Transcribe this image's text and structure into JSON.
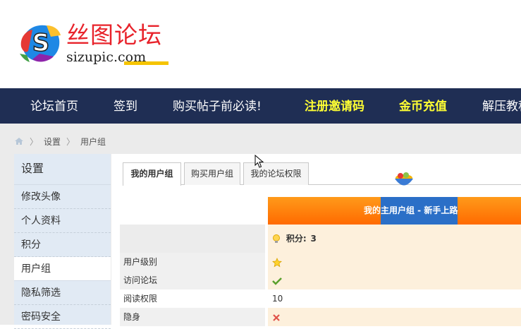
{
  "logo": {
    "title_cn": "丝图论坛",
    "domain": "sizupic.com",
    "mark_letter": "S"
  },
  "nav": {
    "items": [
      {
        "label": "论坛首页",
        "highlight": false
      },
      {
        "label": "签到",
        "highlight": false
      },
      {
        "label": "购买帖子前必读!",
        "highlight": false
      },
      {
        "label": "注册邀请码",
        "highlight": true
      },
      {
        "label": "金币充值",
        "highlight": true
      },
      {
        "label": "解压教程",
        "highlight": false
      }
    ],
    "bg_color": "#1f2e54",
    "highlight_color": "#ffff33"
  },
  "breadcrumb": {
    "home_icon": "home-icon",
    "items": [
      "设置",
      "用户组"
    ]
  },
  "sidebar": {
    "title": "设置",
    "items": [
      "修改头像",
      "个人资料",
      "积分",
      "用户组",
      "隐私筛选",
      "密码安全"
    ],
    "active_index": 3
  },
  "tabs": [
    {
      "label": "我的用户组",
      "active": true
    },
    {
      "label": "购买用户组",
      "active": false
    },
    {
      "label": "我的论坛权限",
      "active": false
    }
  ],
  "group_header": {
    "text": "我的主用户组 - 新手上路",
    "color_start": "#ff9a1a",
    "color_mid": "#2b6fc7"
  },
  "points_row": {
    "label": "积分:",
    "value": "3",
    "icon": "lightbulb-icon"
  },
  "permission_rows": [
    {
      "label": "用户级别",
      "icon": "star-icon",
      "value": ""
    },
    {
      "label": "访问论坛",
      "icon": "check-icon",
      "value": ""
    },
    {
      "label": "阅读权限",
      "icon": "",
      "value": "10"
    },
    {
      "label": "隐身",
      "icon": "cross-icon",
      "value": ""
    }
  ]
}
